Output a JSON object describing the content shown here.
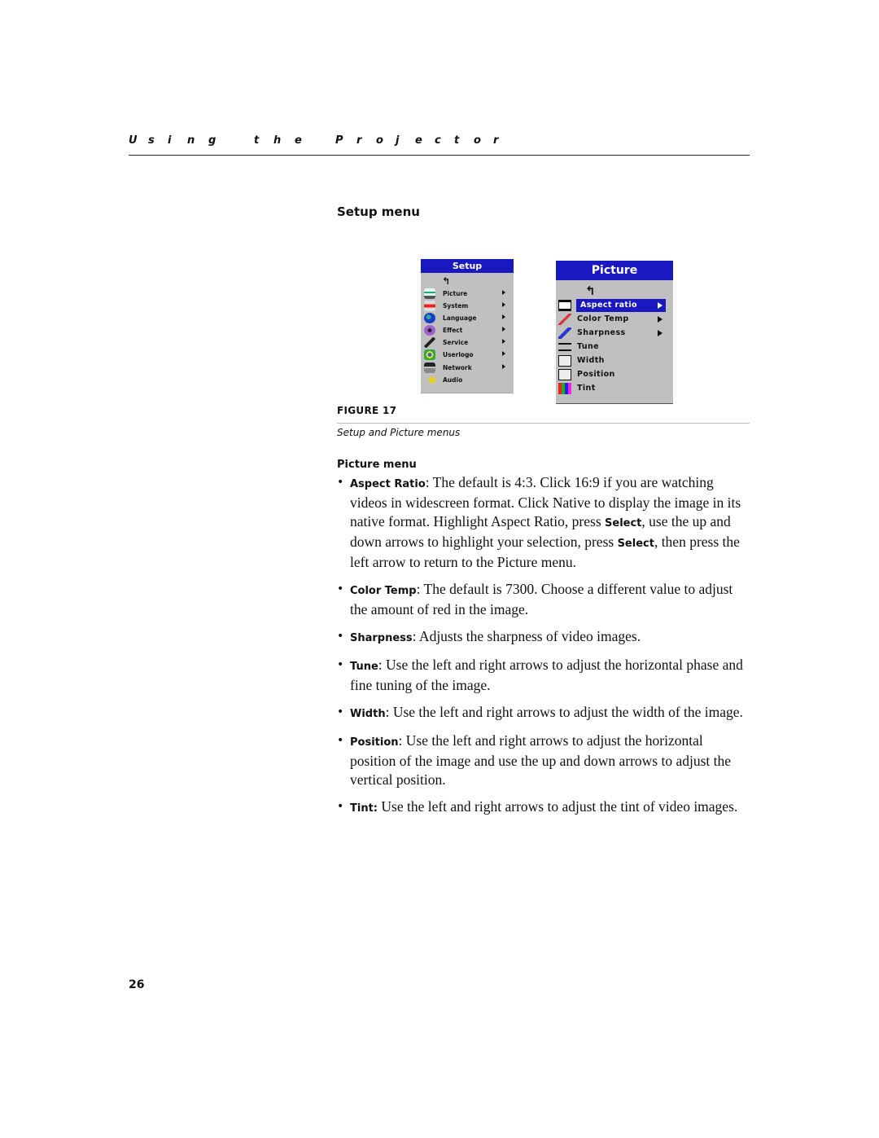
{
  "running_head": [
    "U",
    "s",
    "i",
    "n",
    "g",
    " ",
    "t",
    "h",
    "e",
    " ",
    "P",
    "r",
    "o",
    "j",
    "e",
    "c",
    "t",
    "o",
    "r"
  ],
  "running_head_text": "Using the Projector",
  "section_title": "Setup menu",
  "setup_menu": {
    "title": "Setup",
    "back_icon": "↰",
    "items": [
      {
        "label": "Picture",
        "icon": "picture-icon",
        "has_submenu": true
      },
      {
        "label": "System",
        "icon": "system-icon",
        "has_submenu": true
      },
      {
        "label": "Language",
        "icon": "globe-icon",
        "has_submenu": true
      },
      {
        "label": "Effect",
        "icon": "effect-icon",
        "has_submenu": true
      },
      {
        "label": "Service",
        "icon": "wrench-icon",
        "has_submenu": true
      },
      {
        "label": "Userlogo",
        "icon": "userlogo-icon",
        "has_submenu": true
      },
      {
        "label": "Network",
        "icon": "network-icon",
        "has_submenu": true
      },
      {
        "label": "Audio",
        "icon": "audio-icon",
        "has_submenu": false
      }
    ]
  },
  "picture_menu": {
    "title": "Picture",
    "back_icon": "↰",
    "selected_index": 0,
    "items": [
      {
        "label": "Aspect ratio",
        "icon": "aspect-ratio-icon",
        "has_submenu": true
      },
      {
        "label": "Color Temp",
        "icon": "thermometer-icon",
        "has_submenu": true
      },
      {
        "label": "Sharpness",
        "icon": "sharpness-icon",
        "has_submenu": true
      },
      {
        "label": "Tune",
        "icon": "tune-icon",
        "has_submenu": false
      },
      {
        "label": "Width",
        "icon": "width-icon",
        "has_submenu": false
      },
      {
        "label": "Position",
        "icon": "position-icon",
        "has_submenu": false
      },
      {
        "label": "Tint",
        "icon": "tint-icon",
        "has_submenu": false
      }
    ]
  },
  "colors": {
    "osd_title": "#1a18c0",
    "osd_bg": "#c0c0c0"
  },
  "figure": {
    "label": "FIGURE 17",
    "caption": "Setup and Picture menus"
  },
  "subsection_title": "Picture menu",
  "bullets": [
    {
      "term": "Aspect Ratio",
      "text_parts": [
        ": The default is 4:3. Click 16:9 if you are watching videos in widescreen format. Click Native to display the image in its native format. Highlight Aspect Ratio, press ",
        "Select",
        ", use the up and down arrows to highlight your selection, press ",
        "Select",
        ", then press the left arrow to return to the Picture menu."
      ]
    },
    {
      "term": "Color Temp",
      "text": ": The default is 7300. Choose a different value to adjust the amount of red in the image."
    },
    {
      "term": "Sharpness",
      "text": ": Adjusts the sharpness of video images."
    },
    {
      "term": "Tune",
      "text": ": Use the left and right arrows to adjust the horizontal phase and fine tuning of the image."
    },
    {
      "term": "Width",
      "text": ": Use the left and right arrows to adjust the width of the image."
    },
    {
      "term": "Position",
      "text": ": Use the left and right arrows to adjust the horizontal position of the image and use the up and down arrows to adjust the vertical position."
    },
    {
      "term": "Tint:",
      "text": " Use the left and right arrows to adjust the tint of video images."
    }
  ],
  "page_number": "26"
}
